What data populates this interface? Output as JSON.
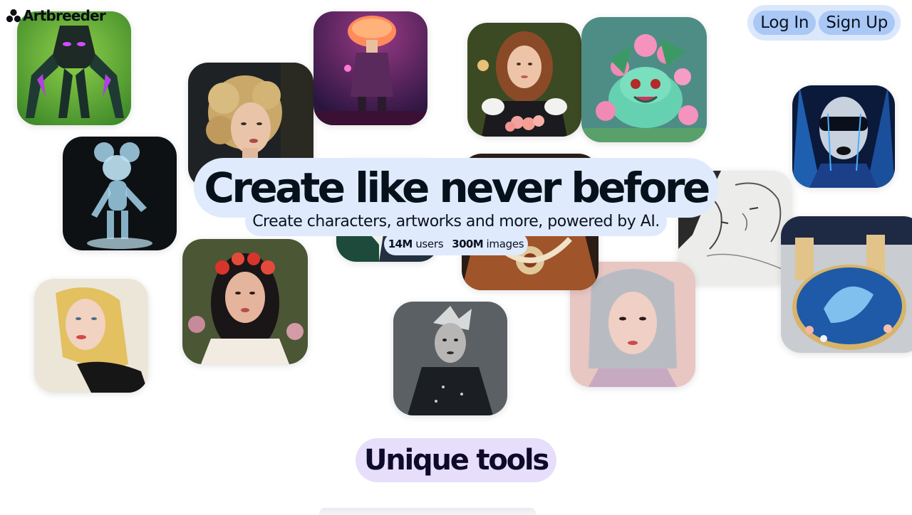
{
  "header": {
    "logo_text": "Artbreeder",
    "logo_icon": "artbreeder-logo-icon",
    "login_label": "Log In",
    "signup_label": "Sign Up"
  },
  "hero": {
    "title": "Create like never before",
    "subtitle": "Create characters, artworks and more, powered by AI.",
    "users_count": "14M",
    "users_label": "users",
    "images_count": "300M",
    "images_label": "images"
  },
  "section": {
    "tools_heading": "Unique tools"
  },
  "gallery": [
    {
      "name": "insect-creature-artwork"
    },
    {
      "name": "curly-hair-woman-portrait"
    },
    {
      "name": "mushroom-head-figure-artwork"
    },
    {
      "name": "victorian-woman-portrait"
    },
    {
      "name": "bulbasaur-flowers-artwork"
    },
    {
      "name": "dark-blue-face-artwork"
    },
    {
      "name": "glass-mickey-mouse-artwork"
    },
    {
      "name": "sketch-couple-artwork"
    },
    {
      "name": "ornate-armor-artwork"
    },
    {
      "name": "ocean-table-room-artwork"
    },
    {
      "name": "flower-crown-woman-portrait"
    },
    {
      "name": "blonde-woman-painting"
    },
    {
      "name": "punk-woman-photo"
    },
    {
      "name": "silver-hair-woman-portrait"
    },
    {
      "name": "green-splash-artwork"
    }
  ],
  "colors": {
    "pill_blue": "#dfeafc",
    "button_blue": "#a9c8f5",
    "pill_purple": "#e6defb"
  }
}
